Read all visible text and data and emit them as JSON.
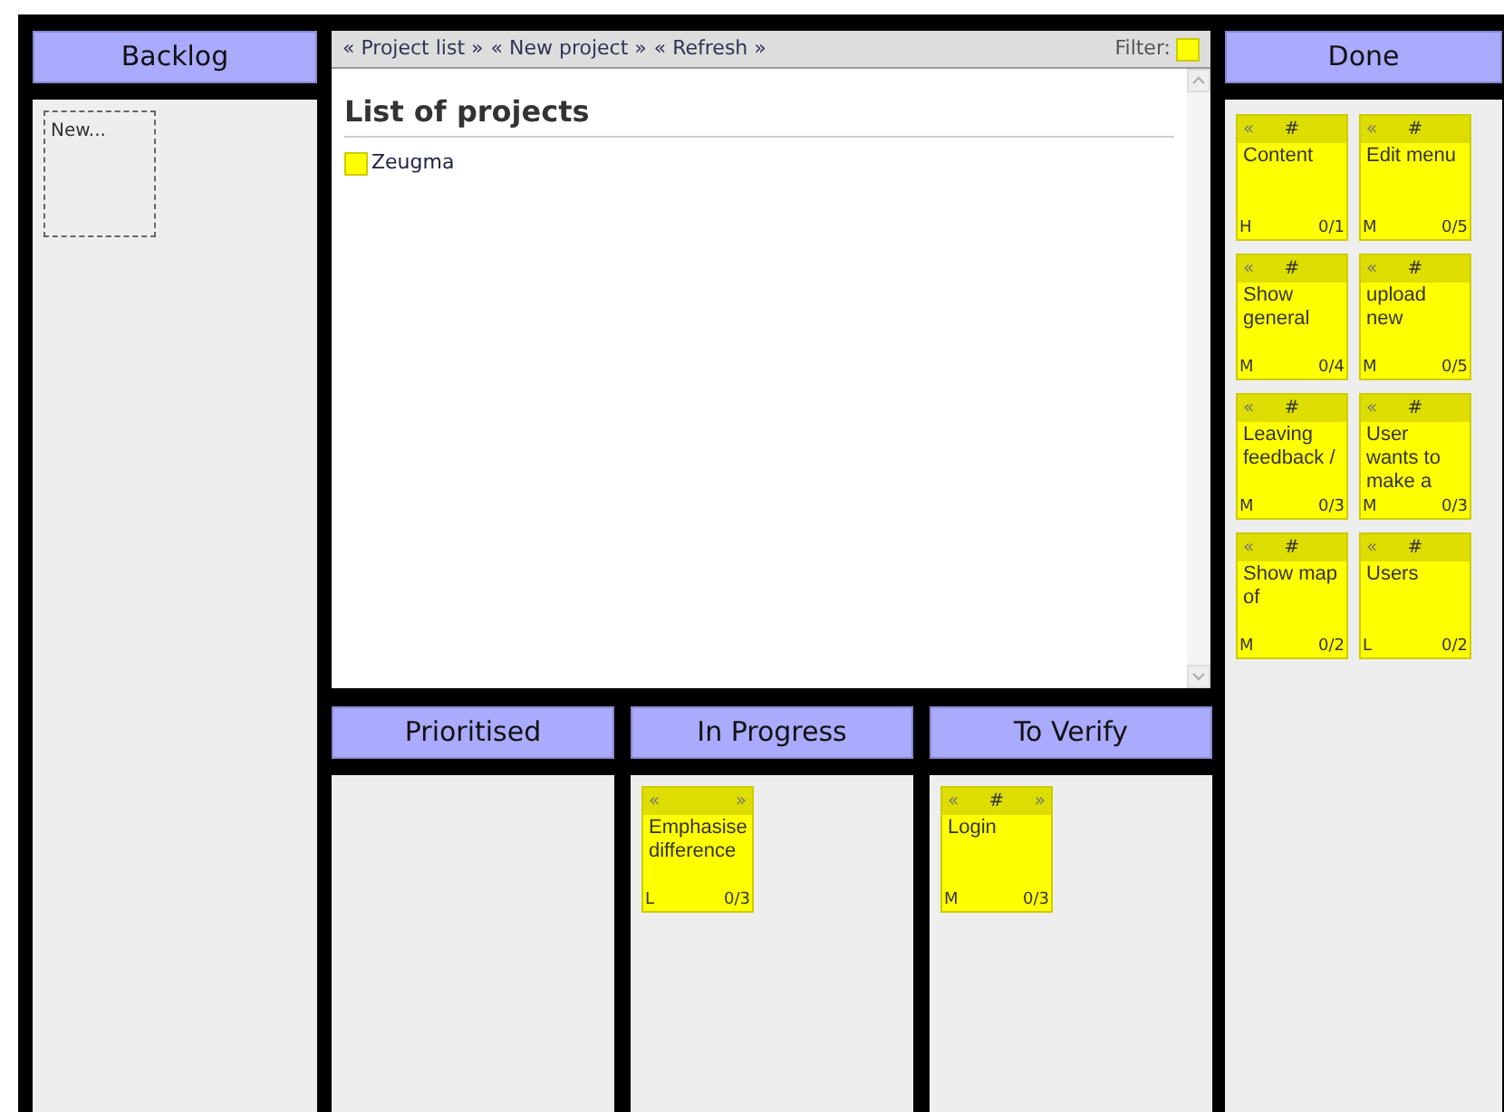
{
  "backlog": {
    "title": "Backlog",
    "new_card": "New..."
  },
  "toolbar": {
    "links": [
      "« Project list »",
      "« New project »",
      "« Refresh »"
    ],
    "filter_label": "Filter:"
  },
  "projects": {
    "heading": "List of projects",
    "items": [
      {
        "name": "Zeugma",
        "color": "#ffff00"
      }
    ]
  },
  "lanes": [
    {
      "title": "Prioritised"
    },
    {
      "title": "In Progress",
      "cards": [
        {
          "left": "«",
          "right": "»",
          "title": "Emphasise difference",
          "priority": "L",
          "tasks": "0/3"
        }
      ]
    },
    {
      "title": "To Verify",
      "cards": [
        {
          "left": "«",
          "center": "#",
          "right": "»",
          "title": "Login",
          "priority": "M",
          "tasks": "0/3"
        }
      ]
    }
  ],
  "done": {
    "title": "Done",
    "cards": [
      {
        "left": "«",
        "center": "#",
        "title": "Content",
        "priority": "H",
        "tasks": "0/1"
      },
      {
        "left": "«",
        "center": "#",
        "title": "Edit menu",
        "priority": "M",
        "tasks": "0/5"
      },
      {
        "left": "«",
        "center": "#",
        "title": "Show general",
        "priority": "M",
        "tasks": "0/4"
      },
      {
        "left": "«",
        "center": "#",
        "title": "upload new",
        "priority": "M",
        "tasks": "0/5"
      },
      {
        "left": "«",
        "center": "#",
        "title": "Leaving feedback /",
        "priority": "M",
        "tasks": "0/3"
      },
      {
        "left": "«",
        "center": "#",
        "title": "User wants to make a",
        "priority": "M",
        "tasks": "0/3"
      },
      {
        "left": "«",
        "center": "#",
        "title": "Show map of",
        "priority": "M",
        "tasks": "0/2"
      },
      {
        "left": "«",
        "center": "#",
        "title": "Users",
        "priority": "L",
        "tasks": "0/2"
      }
    ]
  }
}
